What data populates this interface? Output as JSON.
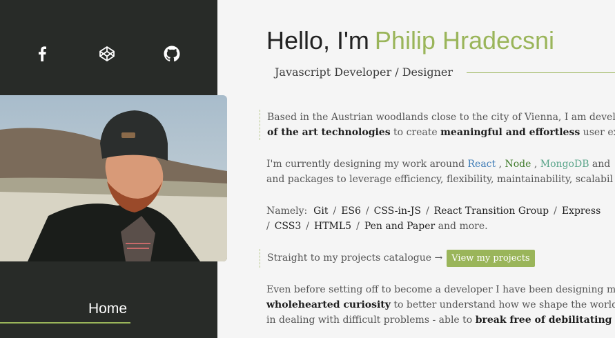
{
  "sidebar": {
    "social": [
      {
        "name": "facebook-icon"
      },
      {
        "name": "codepen-icon"
      },
      {
        "name": "github-icon"
      }
    ],
    "nav": {
      "home": "Home"
    },
    "colors": {
      "background": "#282b28",
      "accent": "#9ab55a"
    }
  },
  "header": {
    "greeting": "Hello, I'm",
    "name": "Philip Hradecsni",
    "role": "Javascript Developer / Designer"
  },
  "intro": {
    "line1": "Based in the Austrian woodlands close to the city of Vienna, I am devel",
    "line2_strong1": "of the art technologies",
    "line2_mid": " to create ",
    "line2_strong2": "meaningful and effortless",
    "line2_end": " user experie"
  },
  "stack": {
    "prefix": "I'm currently designing my work around ",
    "react": "React",
    "sep1": " , ",
    "node": "Node",
    "sep2": " , ",
    "mongo": "MongoDB",
    "suffix": " and",
    "line2": "and packages to leverage efficiency, flexibility, maintainability, scalabil"
  },
  "namely": {
    "label": "Namely:",
    "items_line1": [
      "Git",
      "ES6",
      "CSS-in-JS",
      "React Transition Group",
      "Express"
    ],
    "trailing_slash": "/",
    "items_line2": [
      "CSS3",
      "HTML5",
      "Pen and Paper"
    ],
    "and_more": " and more."
  },
  "cta": {
    "text": "Straight to my projects catalogue →",
    "button": "View my projects"
  },
  "closing": {
    "line1": "Even before setting off to become a developer I have been designing my",
    "line2_strong": "wholehearted curiosity",
    "line2_rest": " to better understand how we shape the world w",
    "line3_start": "in dealing with difficult problems - able to ",
    "line3_strong": "break free of debilitating pat"
  }
}
